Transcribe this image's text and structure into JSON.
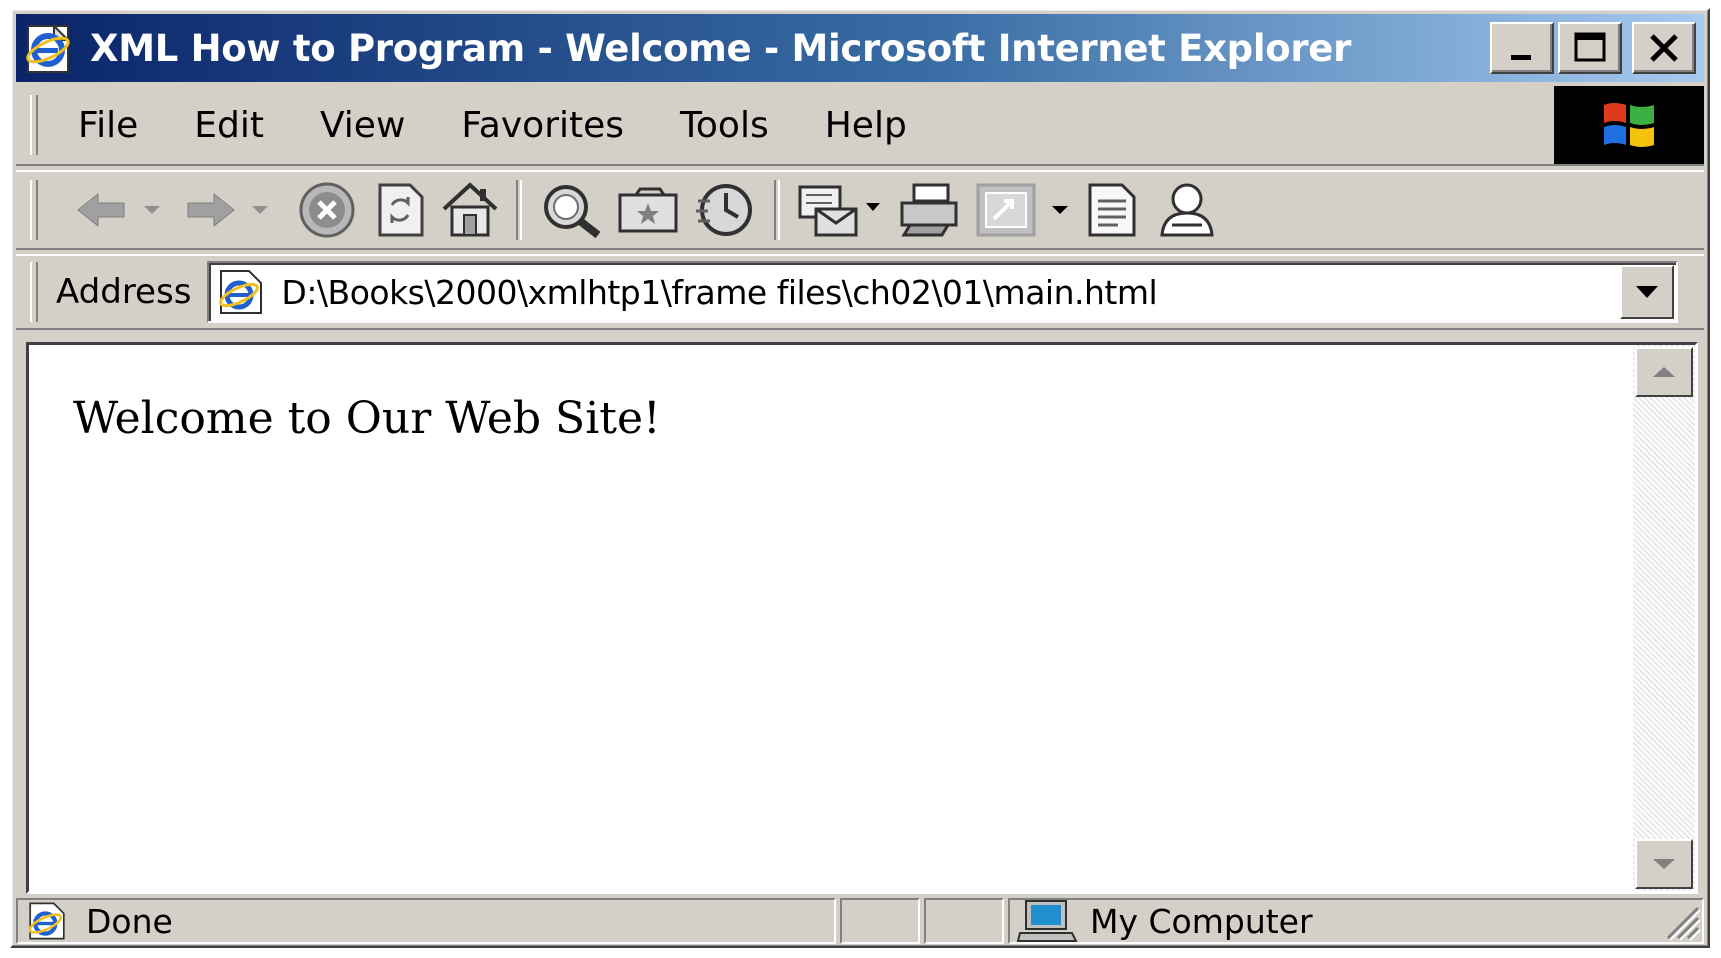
{
  "window": {
    "title": "XML How to Program - Welcome - Microsoft Internet Explorer"
  },
  "menu": {
    "items": [
      "File",
      "Edit",
      "View",
      "Favorites",
      "Tools",
      "Help"
    ]
  },
  "toolbar": {
    "buttons": [
      {
        "icon": "back-arrow-icon"
      },
      {
        "icon": "forward-arrow-icon"
      },
      {
        "icon": "stop-icon"
      },
      {
        "icon": "refresh-icon"
      },
      {
        "icon": "home-icon"
      },
      {
        "icon": "search-icon"
      },
      {
        "icon": "favorites-icon"
      },
      {
        "icon": "history-icon"
      },
      {
        "icon": "mail-icon"
      },
      {
        "icon": "print-icon"
      },
      {
        "icon": "edit-icon"
      },
      {
        "icon": "discuss-icon"
      },
      {
        "icon": "messenger-icon"
      }
    ]
  },
  "address": {
    "label": "Address",
    "value": "D:\\Books\\2000\\xmlhtp1\\frame files\\ch02\\01\\main.html"
  },
  "content": {
    "text": "Welcome to Our Web Site!"
  },
  "status": {
    "text": "Done",
    "zone": "My Computer"
  },
  "colors": {
    "titlebar_start": "#0a246a",
    "titlebar_end": "#a6caf0",
    "chrome": "#d4d0c8"
  }
}
